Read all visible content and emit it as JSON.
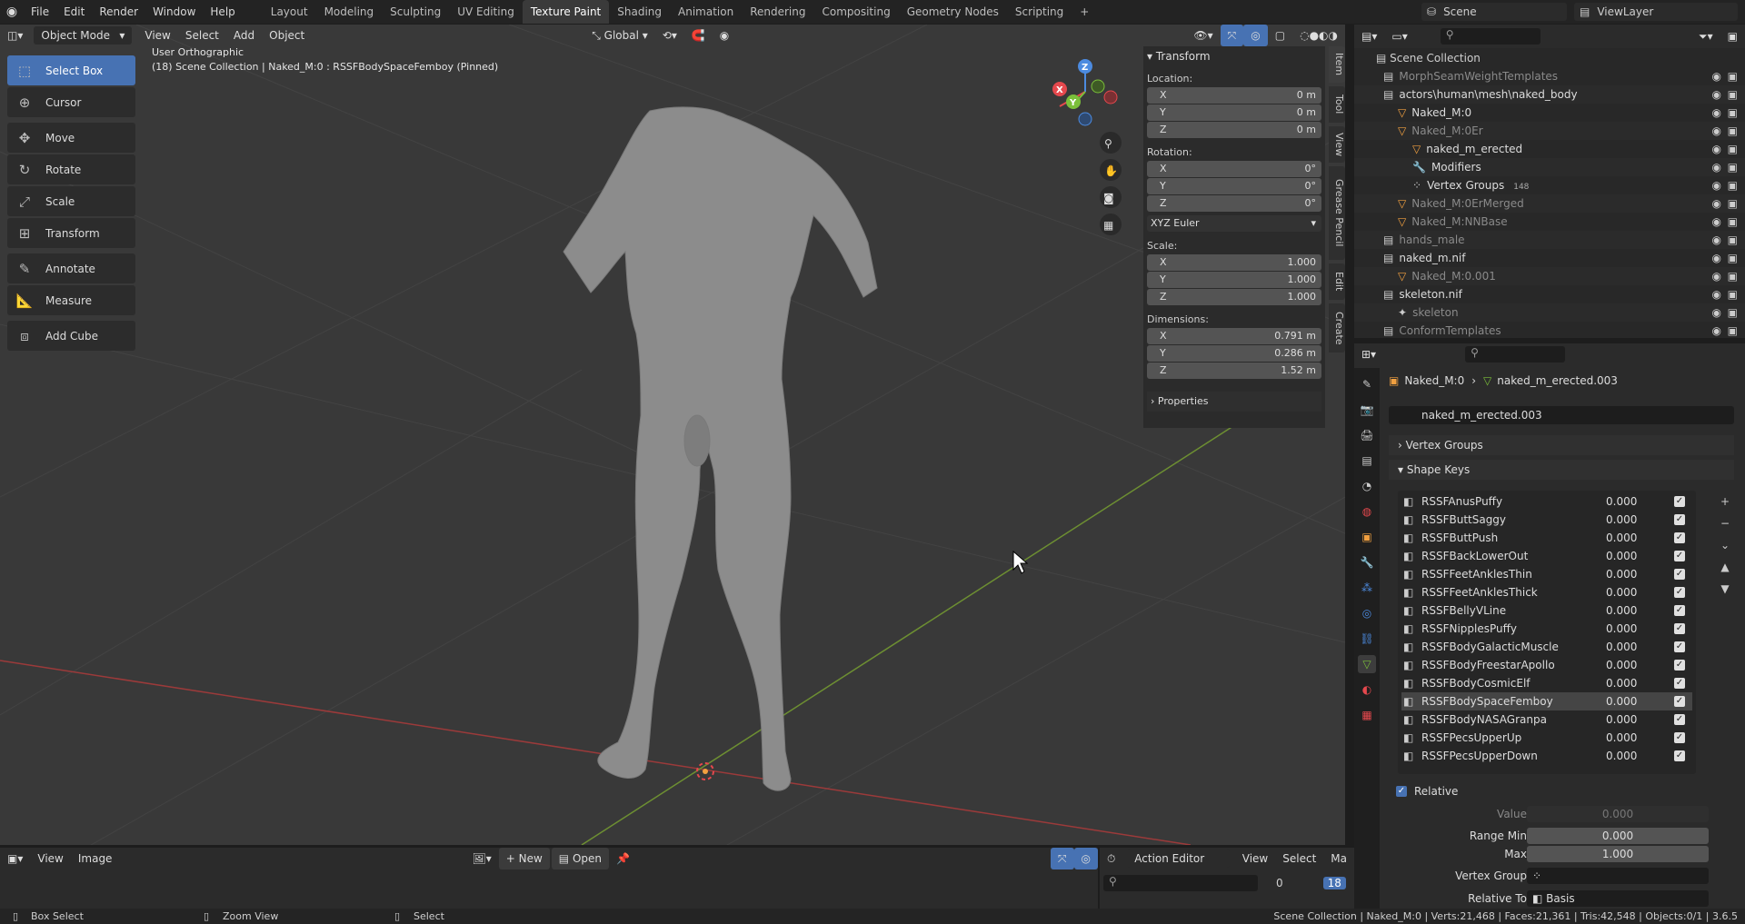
{
  "topbar": {
    "menus": [
      "File",
      "Edit",
      "Render",
      "Window",
      "Help"
    ],
    "workspaces": [
      "Layout",
      "Modeling",
      "Sculpting",
      "UV Editing",
      "Texture Paint",
      "Shading",
      "Animation",
      "Rendering",
      "Compositing",
      "Geometry Nodes",
      "Scripting"
    ],
    "active_workspace": "Texture Paint",
    "add_ws": "+",
    "scene_label": "Scene",
    "viewlayer_label": "ViewLayer"
  },
  "viewport": {
    "mode": "Object Mode",
    "menus": [
      "View",
      "Select",
      "Add",
      "Object"
    ],
    "orientation": "Global",
    "overlay_title": "User Orthographic",
    "overlay_subtitle": "(18) Scene Collection | Naked_M:0 : RSSFBodySpaceFemboy (Pinned)"
  },
  "tools": [
    {
      "label": "Select Box",
      "icon": "select-box-icon",
      "selected": true
    },
    {
      "label": "Cursor",
      "icon": "cursor-icon"
    },
    {
      "label": "Move",
      "icon": "move-icon"
    },
    {
      "label": "Rotate",
      "icon": "rotate-icon"
    },
    {
      "label": "Scale",
      "icon": "scale-icon"
    },
    {
      "label": "Transform",
      "icon": "transform-icon"
    },
    {
      "label": "Annotate",
      "icon": "annotate-icon"
    },
    {
      "label": "Measure",
      "icon": "measure-icon"
    },
    {
      "label": "Add Cube",
      "icon": "add-cube-icon"
    }
  ],
  "npanel": {
    "header": "Transform",
    "location_label": "Location:",
    "location": {
      "x": "0 m",
      "y": "0 m",
      "z": "0 m"
    },
    "rotation_label": "Rotation:",
    "rotation": {
      "x": "0°",
      "y": "0°",
      "z": "0°"
    },
    "rotation_mode": "XYZ Euler",
    "scale_label": "Scale:",
    "scale": {
      "x": "1.000",
      "y": "1.000",
      "z": "1.000"
    },
    "dimensions_label": "Dimensions:",
    "dimensions": {
      "x": "0.791 m",
      "y": "0.286 m",
      "z": "1.52 m"
    },
    "properties_label": "Properties",
    "axis_x": "X",
    "axis_y": "Y",
    "axis_z": "Z",
    "tabs": [
      "Item",
      "Tool",
      "View",
      "Grease Pencil",
      "Edit",
      "Create"
    ]
  },
  "outliner": {
    "root": "Scene Collection",
    "rows": [
      {
        "label": "MorphSeamWeightTemplates",
        "indent": 1,
        "dim": true
      },
      {
        "label": "actors\\human\\mesh\\naked_body",
        "indent": 1,
        "dim": false
      },
      {
        "label": "Naked_M:0",
        "indent": 2,
        "dim": false
      },
      {
        "label": "Naked_M:0Er",
        "indent": 2,
        "dim": true
      },
      {
        "label": "naked_m_erected",
        "indent": 3,
        "dim": false
      },
      {
        "label": "Modifiers",
        "indent": 3,
        "dim": false
      },
      {
        "label": "Vertex Groups",
        "indent": 3,
        "dim": false
      },
      {
        "label": "Naked_M:0ErMerged",
        "indent": 2,
        "dim": true
      },
      {
        "label": "Naked_M:NNBase",
        "indent": 2,
        "dim": true
      },
      {
        "label": "hands_male",
        "indent": 1,
        "dim": true
      },
      {
        "label": "naked_m.nif",
        "indent": 1,
        "dim": false
      },
      {
        "label": "Naked_M:0.001",
        "indent": 2,
        "dim": true
      },
      {
        "label": "skeleton.nif",
        "indent": 1,
        "dim": false
      },
      {
        "label": "skeleton",
        "indent": 2,
        "dim": true
      },
      {
        "label": "ConformTemplates",
        "indent": 1,
        "dim": true
      }
    ],
    "vgroup_count": "148"
  },
  "properties": {
    "breadcrumb_object": "Naked_M:0",
    "breadcrumb_mesh": "naked_m_erected.003",
    "mesh_name": "naked_m_erected.003",
    "vertex_groups_label": "Vertex Groups",
    "shape_keys_label": "Shape Keys",
    "shape_keys": [
      {
        "name": "RSSFAnusPuffy",
        "value": "0.000"
      },
      {
        "name": "RSSFButtSaggy",
        "value": "0.000"
      },
      {
        "name": "RSSFButtPush",
        "value": "0.000"
      },
      {
        "name": "RSSFBackLowerOut",
        "value": "0.000"
      },
      {
        "name": "RSSFFeetAnklesThin",
        "value": "0.000"
      },
      {
        "name": "RSSFFeetAnklesThick",
        "value": "0.000"
      },
      {
        "name": "RSSFBellyVLine",
        "value": "0.000"
      },
      {
        "name": "RSSFNipplesPuffy",
        "value": "0.000"
      },
      {
        "name": "RSSFBodyGalacticMuscle",
        "value": "0.000"
      },
      {
        "name": "RSSFBodyFreestarApollo",
        "value": "0.000"
      },
      {
        "name": "RSSFBodyCosmicElf",
        "value": "0.000"
      },
      {
        "name": "RSSFBodySpaceFemboy",
        "value": "0.000",
        "selected": true
      },
      {
        "name": "RSSFBodyNASAGranpa",
        "value": "0.000"
      },
      {
        "name": "RSSFPecsUpperUp",
        "value": "0.000"
      },
      {
        "name": "RSSFPecsUpperDown",
        "value": "0.000"
      }
    ],
    "relative_label": "Relative",
    "value_label": "Value",
    "value": "0.000",
    "range_min_label": "Range Min",
    "range_min": "0.000",
    "max_label": "Max",
    "max": "1.000",
    "vertex_group_label": "Vertex Group",
    "relative_to_label": "Relative To",
    "relative_to": "Basis"
  },
  "bottom_editor": {
    "menus": [
      "View",
      "Image"
    ],
    "new_label": "New",
    "open_label": "Open"
  },
  "action_editor": {
    "mode": "Action Editor",
    "menus": [
      "View",
      "Select",
      "Ma"
    ],
    "frame_start": "0",
    "frame_current": "18"
  },
  "statusbar": {
    "hint1": "Box Select",
    "hint2": "Zoom View",
    "hint3": "Select",
    "stats": "Scene Collection | Naked_M:0 | Verts:21,468 | Faces:21,361 | Tris:42,548 | Objects:0/1 | 3.6.5"
  },
  "colors": {
    "accent": "#4772b3",
    "active_orange": "#f1a040",
    "x_axis": "#e5484d",
    "y_axis": "#7bbf3a",
    "z_axis": "#4c8be0"
  }
}
